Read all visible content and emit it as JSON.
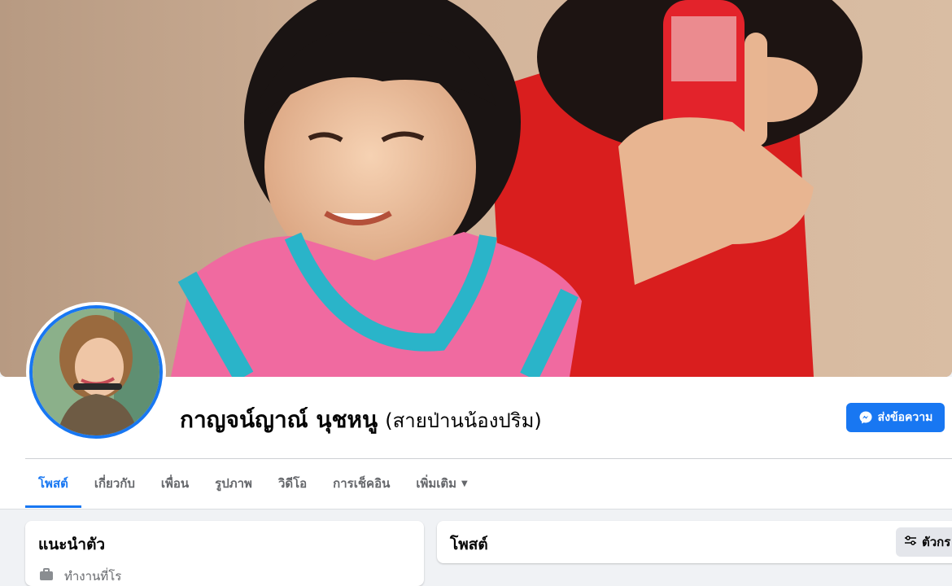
{
  "profile": {
    "name": "กาญจน์ญาณ์ นุชหนู",
    "alternate_name": "(สายป่านน้องปริม)"
  },
  "actions": {
    "message_label": "ส่งข้อความ"
  },
  "tabs": [
    {
      "label": "โพสต์",
      "active": true
    },
    {
      "label": "เกี่ยวกับ"
    },
    {
      "label": "เพื่อน"
    },
    {
      "label": "รูปภาพ"
    },
    {
      "label": "วิดีโอ"
    },
    {
      "label": "การเช็คอิน"
    },
    {
      "label": "เพิ่มเติม"
    }
  ],
  "intro": {
    "title": "แนะนำตัว",
    "first_item_partial": "ทำงานที่โร"
  },
  "posts": {
    "title": "โพสต์",
    "filter_label": "ตัวกร"
  },
  "colors": {
    "accent": "#1877f2",
    "page_bg": "#f0f2f5"
  },
  "icons": {
    "message": "messenger-icon",
    "more": "caret-down-icon",
    "filter": "filter-sliders-icon",
    "work": "briefcase-icon"
  }
}
